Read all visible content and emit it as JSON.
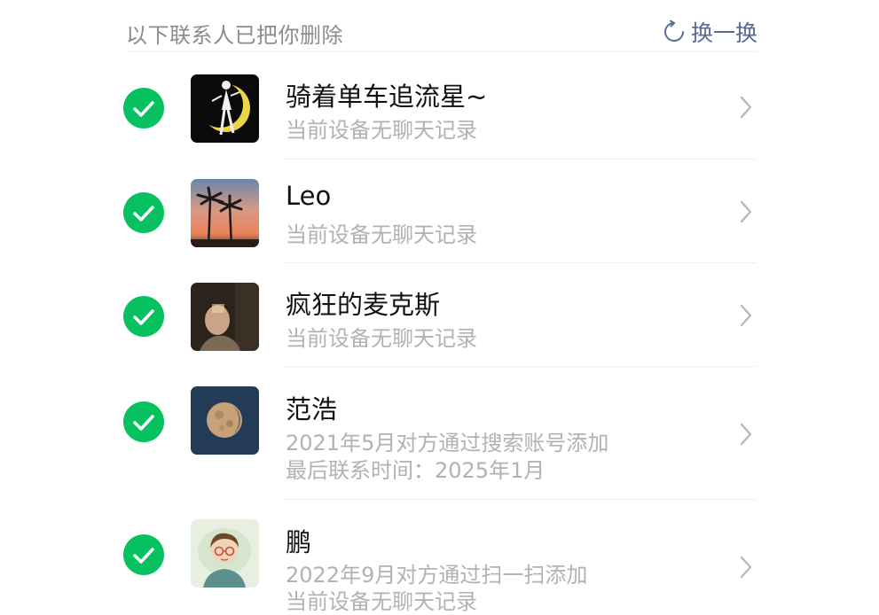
{
  "header": {
    "title": "以下联系人已把你删除",
    "refresh_label": "换一换",
    "link_color": "#576b95"
  },
  "contacts": [
    {
      "name": "骑着单车追流星~",
      "lines": [
        "当前设备无聊天记录"
      ],
      "selected": true,
      "avatar_icon": "sailor-moon-avatar"
    },
    {
      "name": "Leo",
      "lines": [
        "当前设备无聊天记录"
      ],
      "selected": true,
      "avatar_icon": "palm-sunset-avatar"
    },
    {
      "name": "疯狂的麦克斯",
      "lines": [
        "当前设备无聊天记录"
      ],
      "selected": true,
      "avatar_icon": "person-photo-avatar"
    },
    {
      "name": "范浩",
      "lines": [
        "2021年5月对方通过搜索账号添加",
        "最后联系时间：2025年1月"
      ],
      "selected": true,
      "avatar_icon": "moon-avatar"
    },
    {
      "name": "鹏",
      "lines": [
        "2022年9月对方通过扫一扫添加",
        "当前设备无聊天记录"
      ],
      "selected": true,
      "avatar_icon": "cartoon-boy-avatar"
    }
  ],
  "colors": {
    "check_green": "#07c160",
    "name_text": "#111111",
    "sub_text": "#b2b2b2",
    "header_text": "#8c8c8c"
  }
}
